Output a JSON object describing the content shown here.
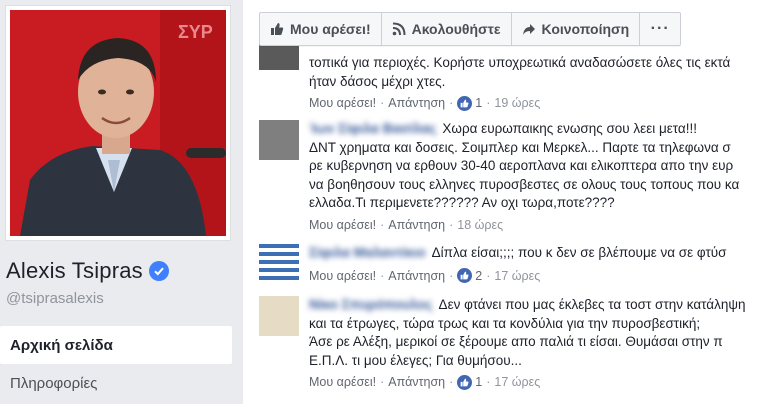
{
  "profile": {
    "name": "Alexis Tsipras",
    "handle": "@tsiprasalexis",
    "nav": [
      "Αρχική σελίδα",
      "Πληροφορίες"
    ]
  },
  "actionbar": {
    "like": "Μου αρέσει!",
    "follow": "Ακολουθήστε",
    "share": "Κοινοποίηση",
    "more": "···"
  },
  "comments": [
    {
      "author": "",
      "lines": [
        "τοπικά για περιοχές. Κορήστε υποχρεωτικά αναδασώσετε όλες τις εκτά",
        "ήταν δάσος μέχρι χτες."
      ],
      "like": "Μου αρέσει!",
      "reply": "Απάντηση",
      "count": "1",
      "time": "19 ώρες"
    },
    {
      "author": "Ίων Σίφιλα Βασίλας",
      "lines": [
        "Χωρα ευρωπαικης ενωσης σου λεει μετα!!!",
        "ΔΝΤ χρηματα και δοσεις. Σοιμπλερ και Μερκελ... Παρτε τα τηλεφωνα σ",
        "ρε κυβερνηση να ερθουν 30-40 αεροπλανα και ελικοπτερα απο την ευρ",
        "να βοηθησουν τους ελληνες πυροσβεστες σε ολους τους τοπους που κα",
        "ελλαδα.Τι περιμενετε?????? Αν οχι τωρα,ποτε????"
      ],
      "like": "Μου αρέσει!",
      "reply": "Απάντηση",
      "count": "",
      "time": "18 ώρες"
    },
    {
      "author": "Σίφιλα Μαλαντίκιο",
      "lines": [
        "Δίπλα είσαι;;;; που κ δεν σε βλέπουμε να σε φτύσ"
      ],
      "like": "Μου αρέσει!",
      "reply": "Απάντηση",
      "count": "2",
      "time": "17 ώρες"
    },
    {
      "author": "Νίκο Σπυρόπουλος",
      "lines": [
        "Δεν φτάνει που μας έκλεβες τα τοστ στην κατάληψη",
        "και τα έτρωγες, τώρα τρως και τα κονδύλια για την πυροσβεστική;",
        "Άσε ρε Αλέξη, μερικοί σε ξέρουμε απο παλιά τι είσαι. Θυμάσαι στην π",
        "Ε.Π.Λ. τι μου έλεγες; Για θυμήσου..."
      ],
      "like": "Μου αρέσει!",
      "reply": "Απάντηση",
      "count": "1",
      "time": "17 ώρες"
    }
  ],
  "colors": {
    "link": "#365899",
    "accent": "#4267b2",
    "verified": "#4080ff",
    "photo_bg": "#d8232a"
  }
}
